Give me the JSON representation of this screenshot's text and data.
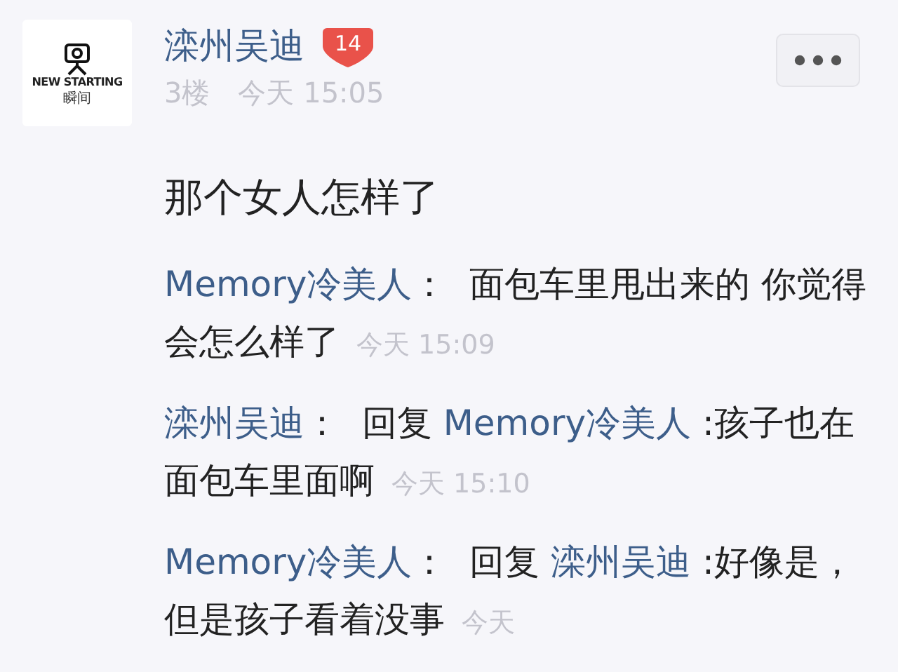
{
  "post": {
    "avatar": {
      "brand": "NEW STARTING",
      "sub": "瞬间"
    },
    "author": "滦州吴迪",
    "level": "14",
    "floor": "3楼",
    "time": "今天 15:05",
    "content": "那个女人怎样了"
  },
  "replies": [
    {
      "author": "Memory冷美人",
      "separator": "：",
      "text": "面包车里甩出来的 你觉得会怎么样了",
      "time": "今天 15:09"
    },
    {
      "author": "滦州吴迪",
      "separator": "：",
      "reply_word": "回复",
      "reply_to": "Memory冷美人",
      "text": ":孩子也在面包车里面啊",
      "time": "今天 15:10"
    },
    {
      "author": "Memory冷美人",
      "separator": "：",
      "reply_word": "回复",
      "reply_to": "滦州吴迪",
      "text": ":好像是，但是孩子看着没事",
      "time": "今天"
    }
  ]
}
